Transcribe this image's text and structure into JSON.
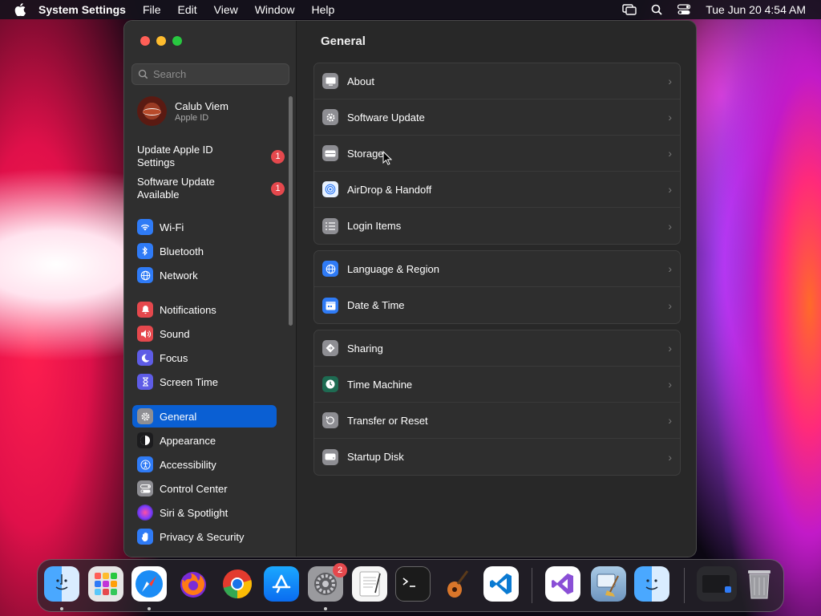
{
  "menubar": {
    "app_name": "System Settings",
    "items": [
      "File",
      "Edit",
      "View",
      "Window",
      "Help"
    ],
    "clock": "Tue Jun 20  4:54 AM"
  },
  "sidebar": {
    "search_placeholder": "Search",
    "profile": {
      "name": "Calub Viem",
      "subtitle": "Apple ID"
    },
    "alerts": [
      {
        "label": "Update Apple ID Settings",
        "badge": "1"
      },
      {
        "label": "Software Update Available",
        "badge": "1"
      }
    ],
    "items": [
      {
        "label": "Wi-Fi",
        "icon": "wifi-icon",
        "color": "#2f7bf6"
      },
      {
        "label": "Bluetooth",
        "icon": "bluetooth-icon",
        "color": "#2f7bf6"
      },
      {
        "label": "Network",
        "icon": "globe-icon",
        "color": "#2f7bf6"
      },
      {
        "label": "Notifications",
        "icon": "bell-icon",
        "color": "#e5484d"
      },
      {
        "label": "Sound",
        "icon": "speaker-icon",
        "color": "#e5484d"
      },
      {
        "label": "Focus",
        "icon": "moon-icon",
        "color": "#5e5ce6"
      },
      {
        "label": "Screen Time",
        "icon": "hourglass-icon",
        "color": "#5e5ce6"
      },
      {
        "label": "General",
        "icon": "gear-icon",
        "color": "#8e8e93"
      },
      {
        "label": "Appearance",
        "icon": "appearance-icon",
        "color": "#1c1c1e"
      },
      {
        "label": "Accessibility",
        "icon": "accessibility-icon",
        "color": "#2f7bf6"
      },
      {
        "label": "Control Center",
        "icon": "toggles-icon",
        "color": "#8e8e93"
      },
      {
        "label": "Siri & Spotlight",
        "icon": "siri-icon",
        "color": "#c235d8"
      },
      {
        "label": "Privacy & Security",
        "icon": "hand-icon",
        "color": "#2f7bf6"
      }
    ]
  },
  "main": {
    "title": "General",
    "groups": [
      [
        {
          "label": "About",
          "icon": "display-icon"
        },
        {
          "label": "Software Update",
          "icon": "gear-badge-icon"
        },
        {
          "label": "Storage",
          "icon": "drive-icon"
        },
        {
          "label": "AirDrop & Handoff",
          "icon": "airdrop-icon"
        },
        {
          "label": "Login Items",
          "icon": "list-icon"
        }
      ],
      [
        {
          "label": "Language & Region",
          "icon": "globe-icon"
        },
        {
          "label": "Date & Time",
          "icon": "calendar-icon"
        }
      ],
      [
        {
          "label": "Sharing",
          "icon": "sharing-icon"
        },
        {
          "label": "Time Machine",
          "icon": "time-machine-icon"
        },
        {
          "label": "Transfer or Reset",
          "icon": "reset-icon"
        },
        {
          "label": "Startup Disk",
          "icon": "disk-icon"
        }
      ]
    ]
  },
  "dock": {
    "apps": [
      "Finder",
      "Launchpad",
      "Safari",
      "Firefox",
      "Chrome",
      "App Store",
      "System Settings",
      "TextEdit",
      "Terminal",
      "GarageBand",
      "VS Code",
      "Visual Studio",
      "Preview Cleaner",
      "Migration Assistant",
      "Downloads",
      "Trash"
    ],
    "system_settings_badge": "2"
  }
}
